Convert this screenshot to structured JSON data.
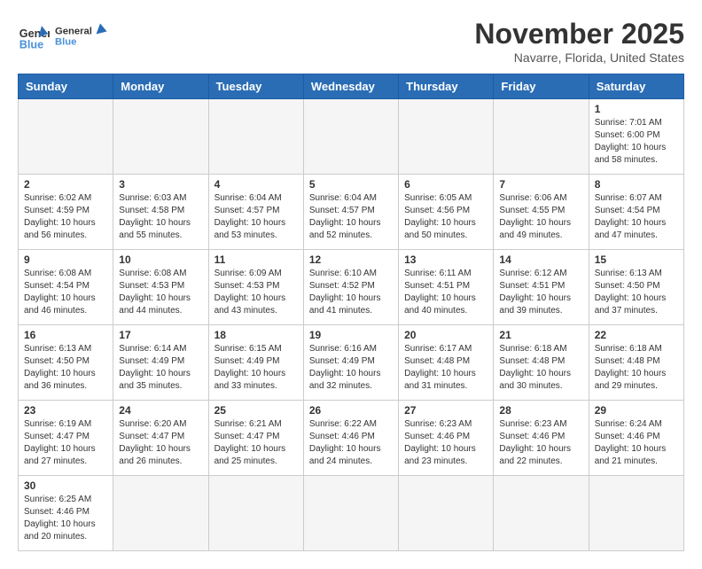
{
  "header": {
    "logo_general": "General",
    "logo_blue": "Blue",
    "month_title": "November 2025",
    "location": "Navarre, Florida, United States"
  },
  "days_of_week": [
    "Sunday",
    "Monday",
    "Tuesday",
    "Wednesday",
    "Thursday",
    "Friday",
    "Saturday"
  ],
  "weeks": [
    [
      {
        "day": "",
        "info": ""
      },
      {
        "day": "",
        "info": ""
      },
      {
        "day": "",
        "info": ""
      },
      {
        "day": "",
        "info": ""
      },
      {
        "day": "",
        "info": ""
      },
      {
        "day": "",
        "info": ""
      },
      {
        "day": "1",
        "info": "Sunrise: 7:01 AM\nSunset: 6:00 PM\nDaylight: 10 hours\nand 58 minutes."
      }
    ],
    [
      {
        "day": "2",
        "info": "Sunrise: 6:02 AM\nSunset: 4:59 PM\nDaylight: 10 hours\nand 56 minutes."
      },
      {
        "day": "3",
        "info": "Sunrise: 6:03 AM\nSunset: 4:58 PM\nDaylight: 10 hours\nand 55 minutes."
      },
      {
        "day": "4",
        "info": "Sunrise: 6:04 AM\nSunset: 4:57 PM\nDaylight: 10 hours\nand 53 minutes."
      },
      {
        "day": "5",
        "info": "Sunrise: 6:04 AM\nSunset: 4:57 PM\nDaylight: 10 hours\nand 52 minutes."
      },
      {
        "day": "6",
        "info": "Sunrise: 6:05 AM\nSunset: 4:56 PM\nDaylight: 10 hours\nand 50 minutes."
      },
      {
        "day": "7",
        "info": "Sunrise: 6:06 AM\nSunset: 4:55 PM\nDaylight: 10 hours\nand 49 minutes."
      },
      {
        "day": "8",
        "info": "Sunrise: 6:07 AM\nSunset: 4:54 PM\nDaylight: 10 hours\nand 47 minutes."
      }
    ],
    [
      {
        "day": "9",
        "info": "Sunrise: 6:08 AM\nSunset: 4:54 PM\nDaylight: 10 hours\nand 46 minutes."
      },
      {
        "day": "10",
        "info": "Sunrise: 6:08 AM\nSunset: 4:53 PM\nDaylight: 10 hours\nand 44 minutes."
      },
      {
        "day": "11",
        "info": "Sunrise: 6:09 AM\nSunset: 4:53 PM\nDaylight: 10 hours\nand 43 minutes."
      },
      {
        "day": "12",
        "info": "Sunrise: 6:10 AM\nSunset: 4:52 PM\nDaylight: 10 hours\nand 41 minutes."
      },
      {
        "day": "13",
        "info": "Sunrise: 6:11 AM\nSunset: 4:51 PM\nDaylight: 10 hours\nand 40 minutes."
      },
      {
        "day": "14",
        "info": "Sunrise: 6:12 AM\nSunset: 4:51 PM\nDaylight: 10 hours\nand 39 minutes."
      },
      {
        "day": "15",
        "info": "Sunrise: 6:13 AM\nSunset: 4:50 PM\nDaylight: 10 hours\nand 37 minutes."
      }
    ],
    [
      {
        "day": "16",
        "info": "Sunrise: 6:13 AM\nSunset: 4:50 PM\nDaylight: 10 hours\nand 36 minutes."
      },
      {
        "day": "17",
        "info": "Sunrise: 6:14 AM\nSunset: 4:49 PM\nDaylight: 10 hours\nand 35 minutes."
      },
      {
        "day": "18",
        "info": "Sunrise: 6:15 AM\nSunset: 4:49 PM\nDaylight: 10 hours\nand 33 minutes."
      },
      {
        "day": "19",
        "info": "Sunrise: 6:16 AM\nSunset: 4:49 PM\nDaylight: 10 hours\nand 32 minutes."
      },
      {
        "day": "20",
        "info": "Sunrise: 6:17 AM\nSunset: 4:48 PM\nDaylight: 10 hours\nand 31 minutes."
      },
      {
        "day": "21",
        "info": "Sunrise: 6:18 AM\nSunset: 4:48 PM\nDaylight: 10 hours\nand 30 minutes."
      },
      {
        "day": "22",
        "info": "Sunrise: 6:18 AM\nSunset: 4:48 PM\nDaylight: 10 hours\nand 29 minutes."
      }
    ],
    [
      {
        "day": "23",
        "info": "Sunrise: 6:19 AM\nSunset: 4:47 PM\nDaylight: 10 hours\nand 27 minutes."
      },
      {
        "day": "24",
        "info": "Sunrise: 6:20 AM\nSunset: 4:47 PM\nDaylight: 10 hours\nand 26 minutes."
      },
      {
        "day": "25",
        "info": "Sunrise: 6:21 AM\nSunset: 4:47 PM\nDaylight: 10 hours\nand 25 minutes."
      },
      {
        "day": "26",
        "info": "Sunrise: 6:22 AM\nSunset: 4:46 PM\nDaylight: 10 hours\nand 24 minutes."
      },
      {
        "day": "27",
        "info": "Sunrise: 6:23 AM\nSunset: 4:46 PM\nDaylight: 10 hours\nand 23 minutes."
      },
      {
        "day": "28",
        "info": "Sunrise: 6:23 AM\nSunset: 4:46 PM\nDaylight: 10 hours\nand 22 minutes."
      },
      {
        "day": "29",
        "info": "Sunrise: 6:24 AM\nSunset: 4:46 PM\nDaylight: 10 hours\nand 21 minutes."
      }
    ],
    [
      {
        "day": "30",
        "info": "Sunrise: 6:25 AM\nSunset: 4:46 PM\nDaylight: 10 hours\nand 20 minutes."
      },
      {
        "day": "",
        "info": ""
      },
      {
        "day": "",
        "info": ""
      },
      {
        "day": "",
        "info": ""
      },
      {
        "day": "",
        "info": ""
      },
      {
        "day": "",
        "info": ""
      },
      {
        "day": "",
        "info": ""
      }
    ]
  ]
}
